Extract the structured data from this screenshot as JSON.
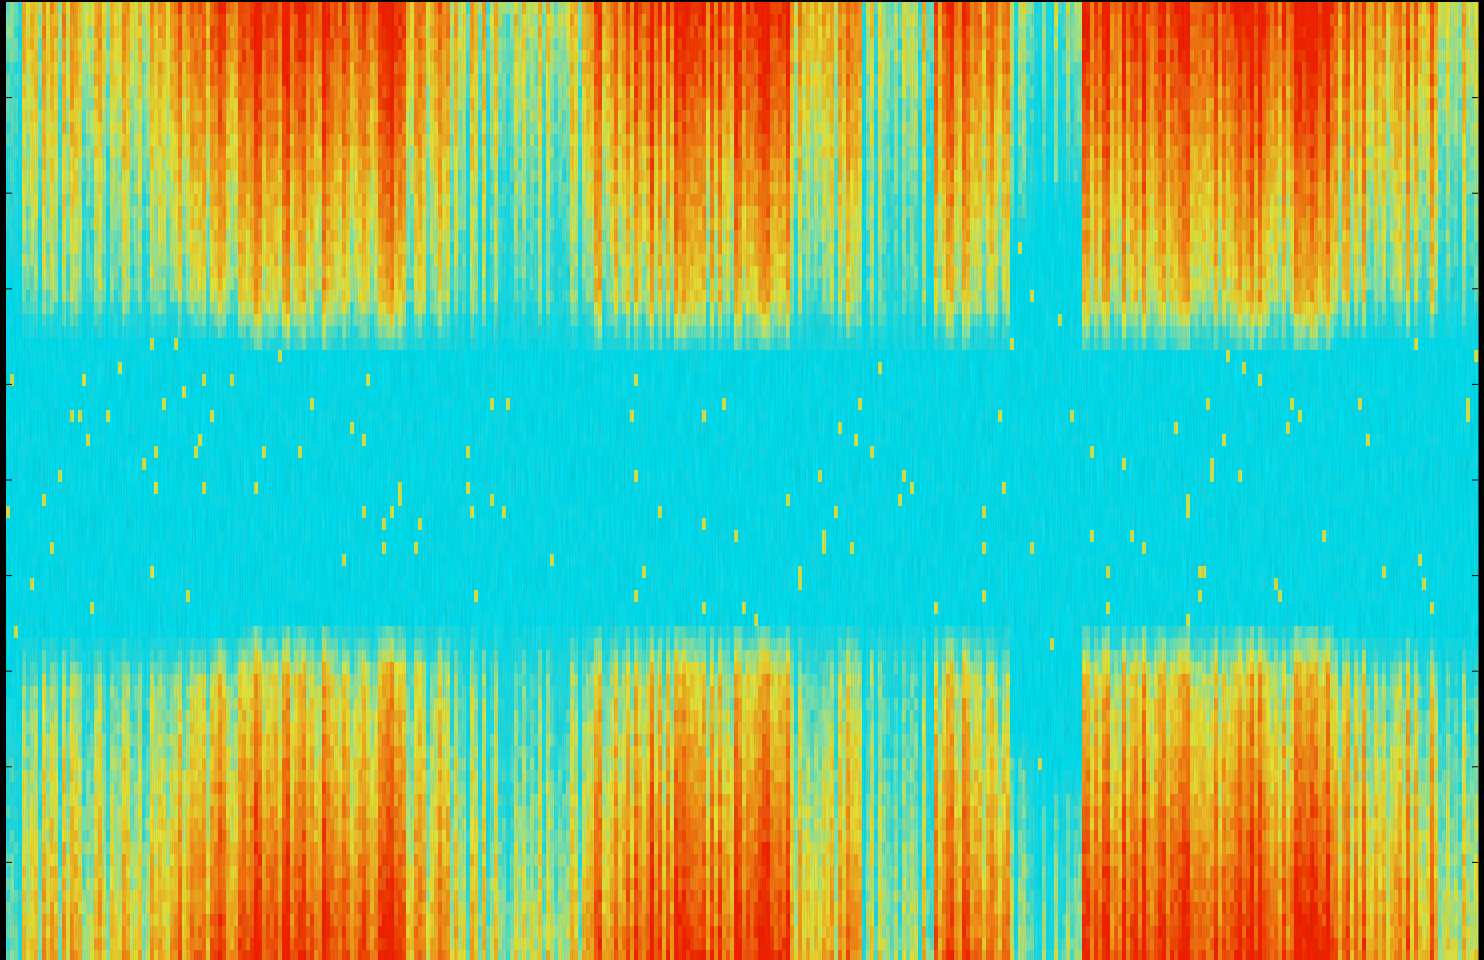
{
  "chart_data": {
    "type": "heatmap",
    "title": "",
    "xlabel": "",
    "ylabel": "",
    "colormap": "jet",
    "colorscale": {
      "low": "#00eaff",
      "mid_low": "#7ef0d0",
      "mid": "#f2ef3c",
      "high_mid": "#ff9a1f",
      "high": "#ff2a00"
    },
    "grid": false,
    "legend": "none",
    "y_symmetric": true,
    "y_ticks": 9,
    "column_profile": [
      {
        "x": [
          0.0,
          0.01
        ],
        "level": 0.35,
        "lowband_top": 0.28
      },
      {
        "x": [
          0.01,
          0.11
        ],
        "level": 0.62,
        "lowband_top": 0.34
      },
      {
        "x": [
          0.11,
          0.16
        ],
        "level": 0.86,
        "lowband_top": 0.34
      },
      {
        "x": [
          0.16,
          0.27
        ],
        "level": 0.95,
        "lowband_top": 0.35
      },
      {
        "x": [
          0.27,
          0.3
        ],
        "level": 0.74,
        "lowband_top": 0.35
      },
      {
        "x": [
          0.3,
          0.39
        ],
        "level": 0.56,
        "lowband_top": 0.35
      },
      {
        "x": [
          0.39,
          0.42
        ],
        "level": 0.82,
        "lowband_top": 0.35
      },
      {
        "x": [
          0.42,
          0.53
        ],
        "level": 0.93,
        "lowband_top": 0.35
      },
      {
        "x": [
          0.53,
          0.58
        ],
        "level": 0.72,
        "lowband_top": 0.35
      },
      {
        "x": [
          0.58,
          0.62
        ],
        "level": 0.45,
        "lowband_top": 0.36
      },
      {
        "x": [
          0.62,
          0.63
        ],
        "level": 0.55,
        "lowband_top": 0.35
      },
      {
        "x": [
          0.63,
          0.68
        ],
        "level": 0.86,
        "lowband_top": 0.35
      },
      {
        "x": [
          0.68,
          0.7
        ],
        "level": 0.42,
        "lowband_top": 0.24
      },
      {
        "x": [
          0.7,
          0.73
        ],
        "level": 0.38,
        "lowband_top": 0.2
      },
      {
        "x": [
          0.73,
          0.79
        ],
        "level": 0.94,
        "lowband_top": 0.35
      },
      {
        "x": [
          0.79,
          0.9
        ],
        "level": 0.96,
        "lowband_top": 0.35
      },
      {
        "x": [
          0.9,
          0.97
        ],
        "level": 0.8,
        "lowband_top": 0.34
      },
      {
        "x": [
          0.97,
          1.0
        ],
        "level": 0.6,
        "lowband_top": 0.34
      }
    ]
  }
}
